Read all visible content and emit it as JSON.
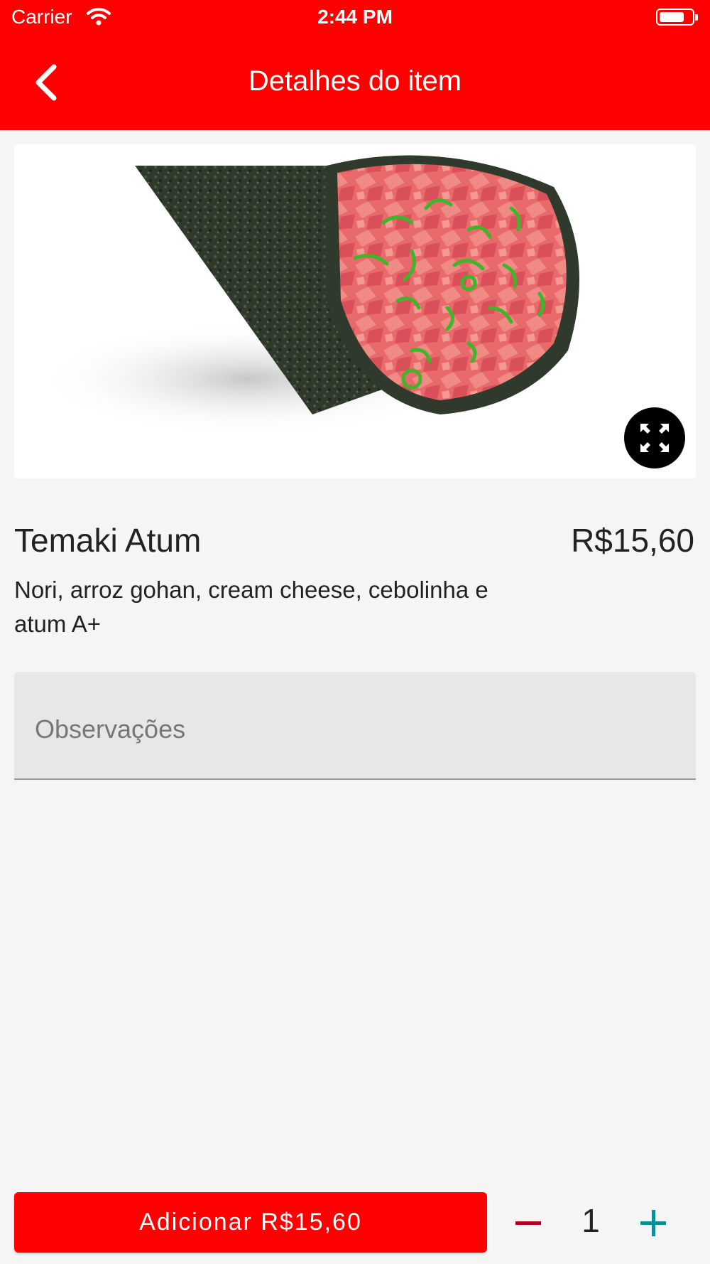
{
  "status_bar": {
    "carrier": "Carrier",
    "time": "2:44 PM"
  },
  "nav": {
    "title": "Detalhes do item",
    "back_icon": "chevron-left-icon"
  },
  "item": {
    "name": "Temaki Atum",
    "price": "R$15,60",
    "description": "Nori, arroz gohan, cream cheese, cebolinha e atum A+",
    "image_subject": "temaki-tuna-photo",
    "expand_icon": "expand-arrows-icon"
  },
  "notes": {
    "placeholder": "Observações"
  },
  "footer": {
    "add_label": "Adicionar R$15,60",
    "quantity": "1"
  },
  "colors": {
    "brand": "#ff0000",
    "minus": "#b00020",
    "plus": "#0e8c99"
  }
}
